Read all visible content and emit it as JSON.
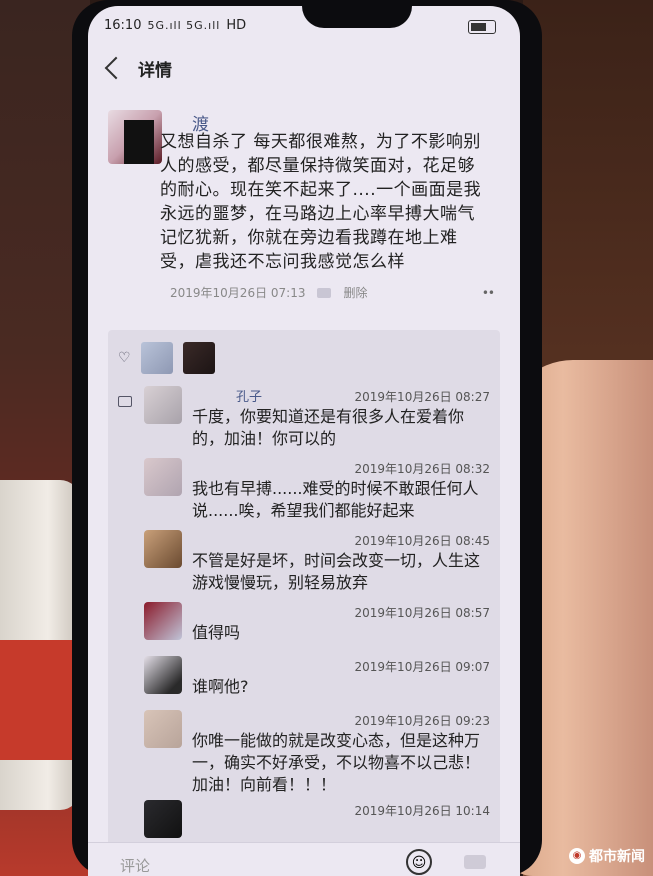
{
  "status": {
    "time": "16:10",
    "signal": "5G.ıll 5G.ıll",
    "network": "HD"
  },
  "nav": {
    "title": "详情"
  },
  "post": {
    "author": "渡",
    "text": "又想自杀了 每天都很难熬，为了不影响别人的感受，都尽量保持微笑面对，花足够的耐心。现在笑不起来了....一个画面是我永远的噩梦，在马路边上心率早搏大喘气记忆犹新，你就在旁边看我蹲在地上难受，虐我还不忘问我感觉怎么样",
    "timestamp": "2019年10月26日 07:13",
    "delete_label": "删除",
    "more": "••"
  },
  "comments": [
    {
      "name": "孔子",
      "time": "2019年10月26日 08:27",
      "text": "千度，你要知道还是有很多人在爱着你的，加油！你可以的"
    },
    {
      "name": "",
      "time": "2019年10月26日 08:32",
      "text": "我也有早搏......难受的时候不敢跟任何人说......唉，希望我们都能好起来"
    },
    {
      "name": "",
      "time": "2019年10月26日 08:45",
      "text": "不管是好是坏，时间会改变一切，人生这游戏慢慢玩，别轻易放弃"
    },
    {
      "name": "",
      "time": "2019年10月26日 08:57",
      "text": "值得吗"
    },
    {
      "name": "",
      "time": "2019年10月26日 09:07",
      "text": "谁啊他?"
    },
    {
      "name": "",
      "time": "2019年10月26日 09:23",
      "text": "你唯一能做的就是改变心态，但是这种万一，确实不好承受，不以物喜不以己悲！加油！向前看！！！"
    },
    {
      "name": "",
      "time": "2019年10月26日 10:14",
      "text": ""
    }
  ],
  "input": {
    "placeholder": "评论"
  },
  "watermark": {
    "text": "都市新闻"
  },
  "colors": {
    "name_link": "#4a5a8a",
    "screen_bg": "#ece8f2",
    "comment_bg": "#dfdbe6"
  }
}
